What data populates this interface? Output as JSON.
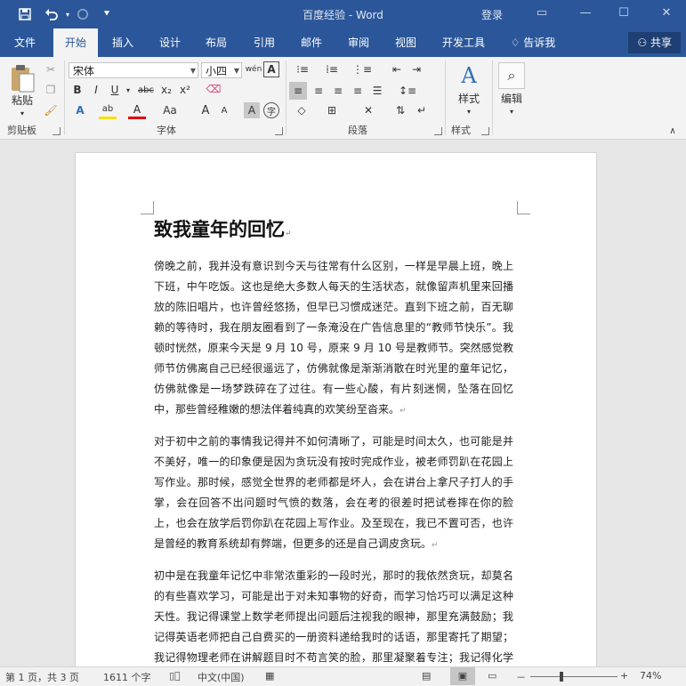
{
  "window": {
    "title": "百度经验 - Word",
    "login_label": "登录",
    "qat": {
      "save_icon": "save-icon",
      "undo_icon": "undo-icon",
      "redo_icon": "redo-icon",
      "customize_icon": "customize-icon"
    }
  },
  "ribbon_tabs": [
    "文件",
    "开始",
    "插入",
    "设计",
    "布局",
    "引用",
    "邮件",
    "审阅",
    "视图",
    "开发工具"
  ],
  "active_tab": "开始",
  "tell_me": "告诉我",
  "share_label": "共享",
  "clipboard": {
    "paste_label": "粘贴",
    "group_label": "剪贴板"
  },
  "font": {
    "font_name": "宋体",
    "font_size": "小四",
    "phonetic_glyph": "wén",
    "group_label": "字体",
    "buttons": [
      "B",
      "I",
      "U",
      "abc",
      "x₂",
      "x²"
    ],
    "row3": [
      "A",
      "ab",
      "A",
      "Aa",
      "A",
      "A",
      "A",
      "字"
    ]
  },
  "paragraph": {
    "group_label": "段落"
  },
  "styles": {
    "label": "样式",
    "group_label": "样式"
  },
  "editing": {
    "label": "编辑"
  },
  "document": {
    "title": "致我童年的回忆",
    "paragraphs": [
      "傍晚之前，我并没有意识到今天与往常有什么区别，一样是早晨上班，晚上下班，中午吃饭。这也是绝大多数人每天的生活状态，就像留声机里来回播放的陈旧唱片，也许曾经悠扬，但早已习惯成迷茫。直到下班之前，百无聊赖的等待时，我在朋友圈看到了一条淹没在广告信息里的“教师节快乐”。我顿时恍然，原来今天是 9 月 10 号，原来 9 月 10 号是教师节。突然感觉教师节仿佛离自己已经很遥远了，仿佛就像是渐渐消散在时光里的童年记忆，仿佛就像是一场梦跌碎在了过往。有一些心酸，有片刻迷惘，坠落在回忆中，那些曾经稚嫩的想法伴着纯真的欢笑纷至沓来。",
      "对于初中之前的事情我记得并不如何清晰了，可能是时间太久，也可能是并不美好，唯一的印象便是因为贪玩没有按时完成作业，被老师罚趴在花园上写作业。那时候，感觉全世界的老师都是坏人，会在讲台上拿尺子打人的手掌，会在回答不出问题时气愤的数落，会在考的很差时把试卷摔在你的脸上，也会在放学后罚你趴在花园上写作业。及至现在，我已不置可否，也许是曾经的教育系统却有弊端，但更多的还是自己调皮贪玩。",
      "初中是在我童年记忆中非常浓重彩的一段时光，那时的我依然贪玩，却莫名的有些喜欢学习，可能是出于对未知事物的好奇，而学习恰巧可以满足这种天性。我记得课堂上数学老师提出问题后注视我的眼神，那里充满鼓励；我记得英语老师把自己自费买的一册资料递给我时的话语，那里寄托了期望；我记得物理老师在讲解题目时不苟言笑的脸，那里凝聚着专注；我记得化学老师在做"
    ]
  },
  "status": {
    "page_info": "第 1 页，共 3 页",
    "word_count": "1611 个字",
    "language": "中文(中国)",
    "zoom_minus": "－",
    "zoom_plus": "+",
    "zoom": "74%",
    "zoom_level": 0.74
  }
}
